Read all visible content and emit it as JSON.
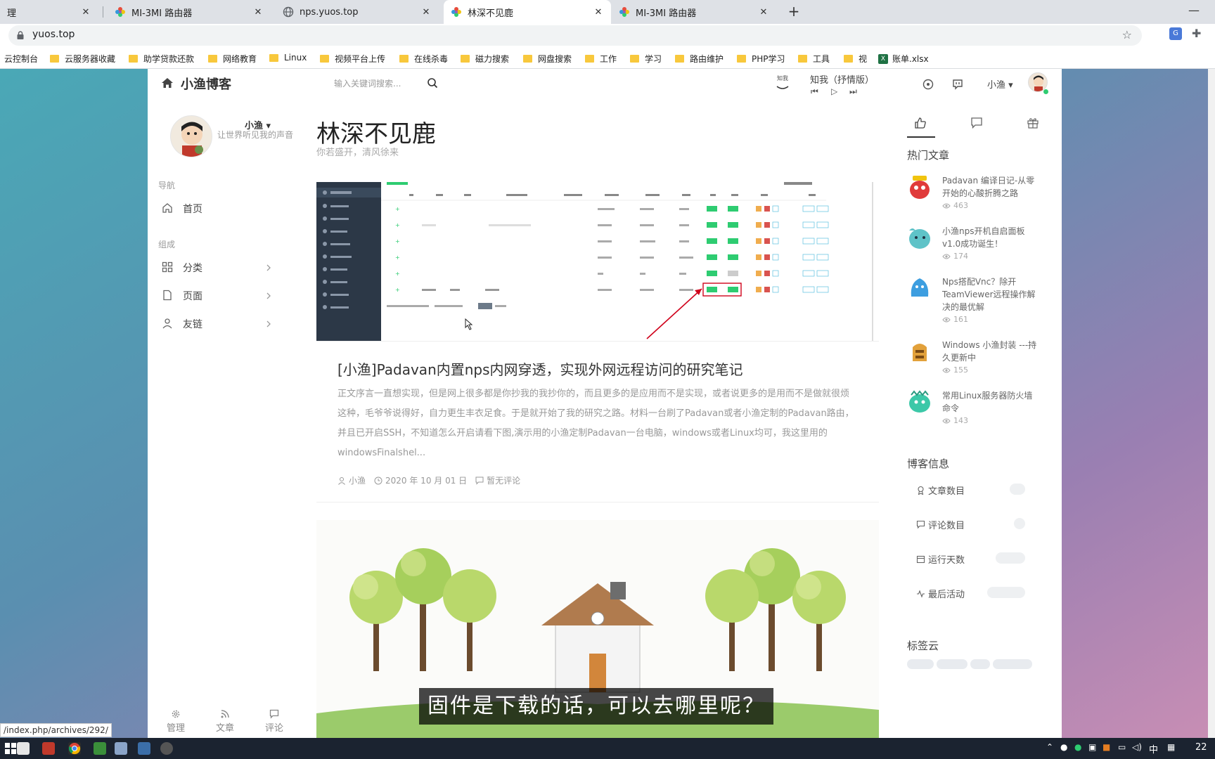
{
  "browser": {
    "tabs": [
      {
        "label": "理",
        "active": false
      },
      {
        "label": "MI-3MI 路由器",
        "active": false
      },
      {
        "label": "nps.yuos.top",
        "active": false
      },
      {
        "label": "林深不见鹿",
        "active": true
      },
      {
        "label": "MI-3MI 路由器",
        "active": false
      }
    ],
    "new_tab": "+",
    "minimize": "—",
    "url": "yuos.top",
    "bookmarks": [
      {
        "label": "云控制台",
        "type": "page"
      },
      {
        "label": "云服务器收藏",
        "type": "folder"
      },
      {
        "label": "助学贷款还款",
        "type": "folder"
      },
      {
        "label": "网络教育",
        "type": "folder"
      },
      {
        "label": "Linux",
        "type": "folder"
      },
      {
        "label": "视频平台上传",
        "type": "folder"
      },
      {
        "label": "在线杀毒",
        "type": "folder"
      },
      {
        "label": "磁力搜索",
        "type": "folder"
      },
      {
        "label": "网盘搜索",
        "type": "folder"
      },
      {
        "label": "工作",
        "type": "folder"
      },
      {
        "label": "学习",
        "type": "folder"
      },
      {
        "label": "路由维护",
        "type": "folder"
      },
      {
        "label": "PHP学习",
        "type": "folder"
      },
      {
        "label": "工具",
        "type": "folder"
      },
      {
        "label": "视",
        "type": "folder"
      },
      {
        "label": "账单.xlsx",
        "type": "excel"
      }
    ],
    "excel_glyph": "X",
    "status_url": "/index.php/archives/292/"
  },
  "blog": {
    "header": {
      "title": "小渔博客",
      "search_placeholder": "输入关键词搜索...",
      "song": "知我（抒情版）",
      "player_cover_text": "知我",
      "user": "小渔"
    },
    "profile": {
      "name": "小渔",
      "motto": "让世界听见我的声音"
    },
    "nav": {
      "head1": "导航",
      "home": "首页",
      "head2": "组成",
      "categories": "分类",
      "pages": "页面",
      "links": "友链"
    },
    "bottom_tools": [
      {
        "label": "管理"
      },
      {
        "label": "文章"
      },
      {
        "label": "评论"
      }
    ],
    "main": {
      "title": "林深不见鹿",
      "subtitle": "你若盛开，清风徐来",
      "post": {
        "title": "[小渔]Padavan内置nps内网穿透，实现外网远程访问的研究笔记",
        "excerpt": "正文序言一直想实现，但是网上很多都是你抄我的我抄你的，而且更多的是应用而不是实现，或者说更多的是用而不是做就很烦这种，毛爷爷说得好，自力更生丰衣足食。于是就开始了我的研究之路。材料一台刷了Padavan或者小渔定制的Padavan路由，并且已开启SSH，不知道怎么开启请看下图,演示用的小渔定制Padavan一台电脑，windows或者Linux均可，我这里用的windowsFinalshel...",
        "author": "小渔",
        "date": "2020 年 10 月 01 日",
        "comments": "暂无评论"
      },
      "video_subtitle": "固件是下载的话，可以去哪里呢？"
    },
    "right": {
      "hot_head": "热门文章",
      "hot": [
        {
          "title": "Padavan 编译日记-从零开始的心酸折腾之路",
          "views": "463",
          "color": "#e03b3b"
        },
        {
          "title": "小渔nps开机自启面板v1.0成功诞生！",
          "views": "174",
          "color": "#5fc3c8"
        },
        {
          "title": "Nps搭配Vnc？除开TeamViewer远程操作解决的最优解",
          "views": "161",
          "color": "#3d9ee0"
        },
        {
          "title": "Windows 小渔封装 ---持久更新中",
          "views": "155",
          "color": "#e2a13b"
        },
        {
          "title": "常用Linux服务器防火墙命令",
          "views": "143",
          "color": "#3cc8a8"
        }
      ],
      "info_head": "博客信息",
      "stats": [
        {
          "label": "文章数目"
        },
        {
          "label": "评论数目"
        },
        {
          "label": "运行天数"
        },
        {
          "label": "最后活动"
        }
      ],
      "tags_head": "标签云"
    }
  },
  "taskbar": {
    "ime": "中",
    "clock": "22"
  }
}
